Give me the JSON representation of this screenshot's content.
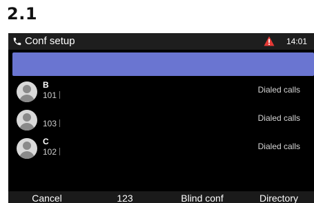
{
  "step_label": "2.1",
  "status_bar": {
    "title": "Conf setup",
    "time": "14:01",
    "icons": [
      "phone-icon",
      "alert-triangle-icon"
    ],
    "alert_color": "#e53935"
  },
  "search_bar": {
    "value": "",
    "color": "#6a75d1"
  },
  "contacts": [
    {
      "name": "B",
      "number": "101",
      "type": "Dialed calls"
    },
    {
      "name": "",
      "number": "103",
      "type": "Dialed calls"
    },
    {
      "name": "C",
      "number": "102",
      "type": "Dialed calls"
    }
  ],
  "softkeys": [
    "Cancel",
    "123",
    "Blind conf",
    "Directory"
  ]
}
